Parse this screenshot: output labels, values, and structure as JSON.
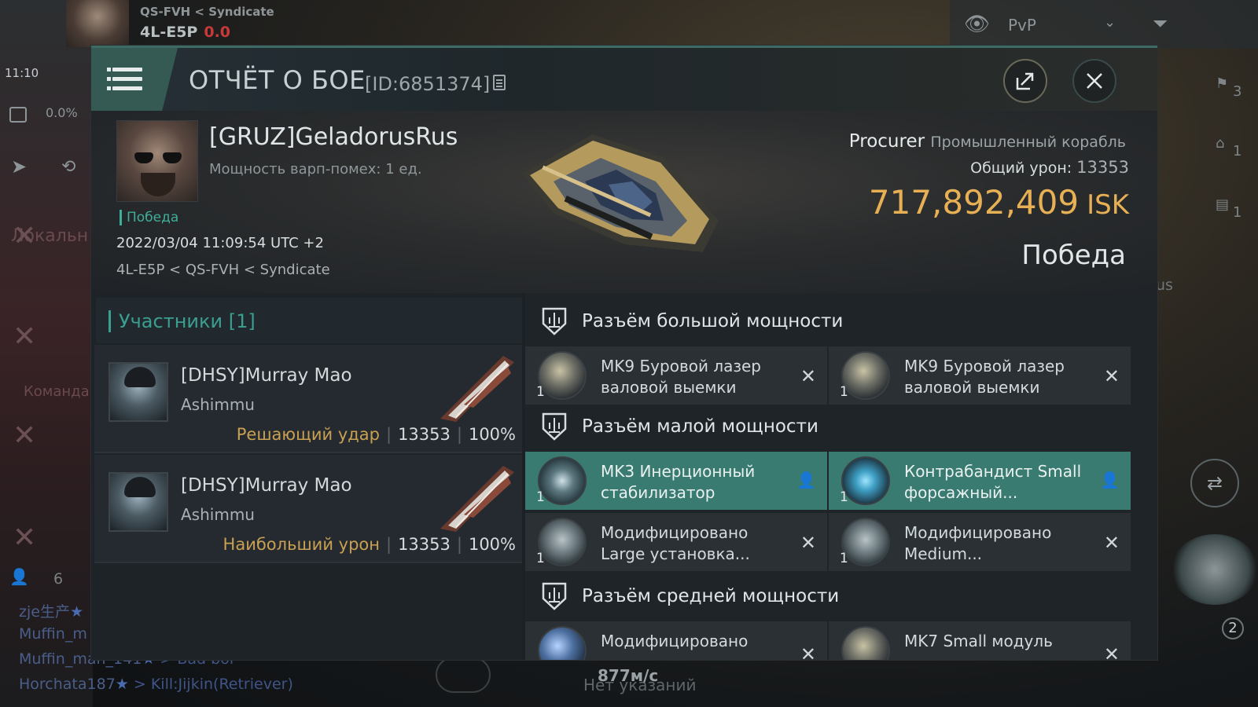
{
  "background": {
    "location_top": "QS-FVH < Syndicate",
    "location_system": "4L-E5P",
    "location_sec": "0.0",
    "time": "11:10",
    "cargo": "0.0%",
    "chat_local": "Локальн",
    "chat_team": "Команда",
    "people_count": "6",
    "filter": "PvP",
    "chat_lines": [
      {
        "name": "zje生产",
        "msg": ""
      },
      {
        "name": "Muffin_m",
        "msg": ""
      },
      {
        "name": "Muffin_man_141",
        "msg": "> Bad boi"
      },
      {
        "name": "Horchata187",
        "msg": "> Kill:Jijkin(Retriever)"
      }
    ],
    "right_counts": [
      "3",
      "1",
      "1"
    ],
    "us_text": "us",
    "speed": "877м/с",
    "no_orders": "Нет указаний",
    "badge_2": "2"
  },
  "report": {
    "title": "ОТЧЁТ О БОЕ",
    "id": "[ID:6851374]"
  },
  "victim": {
    "name": "[GRUZ]GeladorusRus",
    "warp_disrupt": "Мощность варп-помех: 1 ед.",
    "result_tag": "Победа",
    "datetime": "2022/03/04 11:09:54 UTC +2",
    "location": "4L-E5P < QS-FVH < Syndicate",
    "ship_name": "Procurer",
    "ship_class": "Промышленный корабль",
    "total_damage_label": "Общий урон:",
    "total_damage": "13353",
    "isk_value": "717,892,409",
    "isk_unit": "ISK",
    "result": "Победа"
  },
  "participants": {
    "header": "Участники [1]",
    "rows": [
      {
        "name": "[DHSY]Murray Mao",
        "ship": "Ashimmu",
        "role": "Решающий удар",
        "damage": "13353",
        "percent": "100%"
      },
      {
        "name": "[DHSY]Murray Mao",
        "ship": "Ashimmu",
        "role": "Наибольший урон",
        "damage": "13353",
        "percent": "100%"
      }
    ]
  },
  "fitting": {
    "high_label": "Разъём большой мощности",
    "low_label": "Разъём малой мощности",
    "mid_label": "Разъём средней мощности",
    "high": [
      {
        "name": "MK9 Буровой лазер валовой выемки",
        "qty": "1",
        "status": "x"
      },
      {
        "name": "MK9 Буровой лазер валовой выемки",
        "qty": "1",
        "status": "x"
      }
    ],
    "low": [
      {
        "name": "MK3 Инерционный стабилизатор",
        "qty": "1",
        "status": "person",
        "active": true
      },
      {
        "name": "Контрабандист Small форсажный...",
        "qty": "1",
        "status": "person",
        "active": true
      },
      {
        "name": "Модифицировано Large установка...",
        "qty": "1",
        "status": "x"
      },
      {
        "name": "Модифицировано Medium...",
        "qty": "1",
        "status": "x"
      }
    ],
    "mid": [
      {
        "name": "Модифицировано",
        "qty": "",
        "status": "x"
      },
      {
        "name": "MK7 Small модуль",
        "qty": "",
        "status": "x"
      }
    ]
  }
}
